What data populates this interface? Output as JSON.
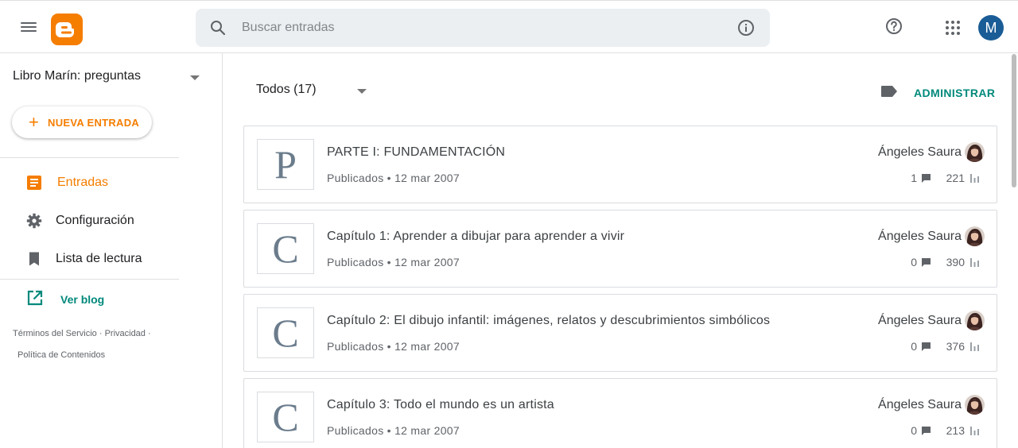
{
  "colors": {
    "accent_orange": "#f57d00",
    "teal": "#00897b",
    "avatar_blue": "#1a5c96",
    "icon_gray": "#5f6368"
  },
  "header": {
    "menu_icon": "hamburger-menu-icon",
    "logo_icon": "blogger-logo-icon",
    "search_placeholder": "Buscar entradas",
    "search_icon": "search-icon",
    "info_icon": "info-icon",
    "help_icon": "help-icon",
    "apps_icon": "apps-grid-icon",
    "account_initial": "M"
  },
  "sidebar": {
    "blog_name": "Libro Marín: preguntas",
    "new_post_label": "NUEVA ENTRADA",
    "items": [
      {
        "label": "Entradas",
        "icon": "posts-icon",
        "active": true
      },
      {
        "label": "Configuración",
        "icon": "gear-icon",
        "active": false
      },
      {
        "label": "Lista de lectura",
        "icon": "bookmark-icon",
        "active": false
      }
    ],
    "view_blog_label": "Ver blog",
    "footer": {
      "terms": "Términos del Servicio",
      "privacy": "Privacidad",
      "content_policy": "Política de Contenidos"
    }
  },
  "main": {
    "filter_label": "Todos (17)",
    "manage_label": "ADMINISTRAR",
    "posts": [
      {
        "thumb_letter": "P",
        "title": "PARTE I: FUNDAMENTACIÓN",
        "status": "Publicados • 12 mar 2007",
        "author": "Ángeles Saura",
        "comments": "1",
        "views": "221"
      },
      {
        "thumb_letter": "C",
        "title": "Capítulo 1: Aprender a dibujar para aprender a vivir",
        "status": "Publicados • 12 mar 2007",
        "author": "Ángeles Saura",
        "comments": "0",
        "views": "390"
      },
      {
        "thumb_letter": "C",
        "title": "Capítulo 2: El dibujo infantil: imágenes, relatos y descubrimientos simbólicos",
        "status": "Publicados • 12 mar 2007",
        "author": "Ángeles Saura",
        "comments": "0",
        "views": "376"
      },
      {
        "thumb_letter": "C",
        "title": "Capítulo 3: Todo el mundo es un artista",
        "status": "Publicados • 12 mar 2007",
        "author": "Ángeles Saura",
        "comments": "0",
        "views": "213"
      }
    ]
  }
}
